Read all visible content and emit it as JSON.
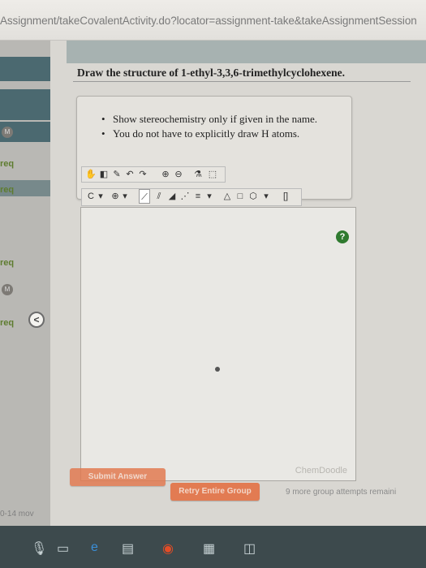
{
  "browser": {
    "url": "Assignment/takeCovalentActivity.do?locator=assignment-take&takeAssignmentSession"
  },
  "sidebar": {
    "labels": [
      "req",
      "req",
      "req",
      "req"
    ],
    "badges": [
      "M",
      "M"
    ],
    "collapse_glyph": "<"
  },
  "question": {
    "text": "Draw the structure of 1-ethyl-3,3,6-trimethylcyclohexene."
  },
  "hints": [
    "Show stereochemistry only if given in the name.",
    "You do not have to explicitly draw H atoms."
  ],
  "editor": {
    "help_glyph": "?",
    "brand": "ChemDoodle",
    "atom_label": "C"
  },
  "actions": {
    "submit_label": "Submit Answer",
    "retry_label": "Retry Entire Group",
    "attempts_text": "9 more group attempts remaini"
  },
  "footer": {
    "date": "0-14 mov"
  },
  "colors": {
    "accent": "#e27b52",
    "help": "#2f7a2f",
    "sidebar_active": "#4b6970"
  }
}
